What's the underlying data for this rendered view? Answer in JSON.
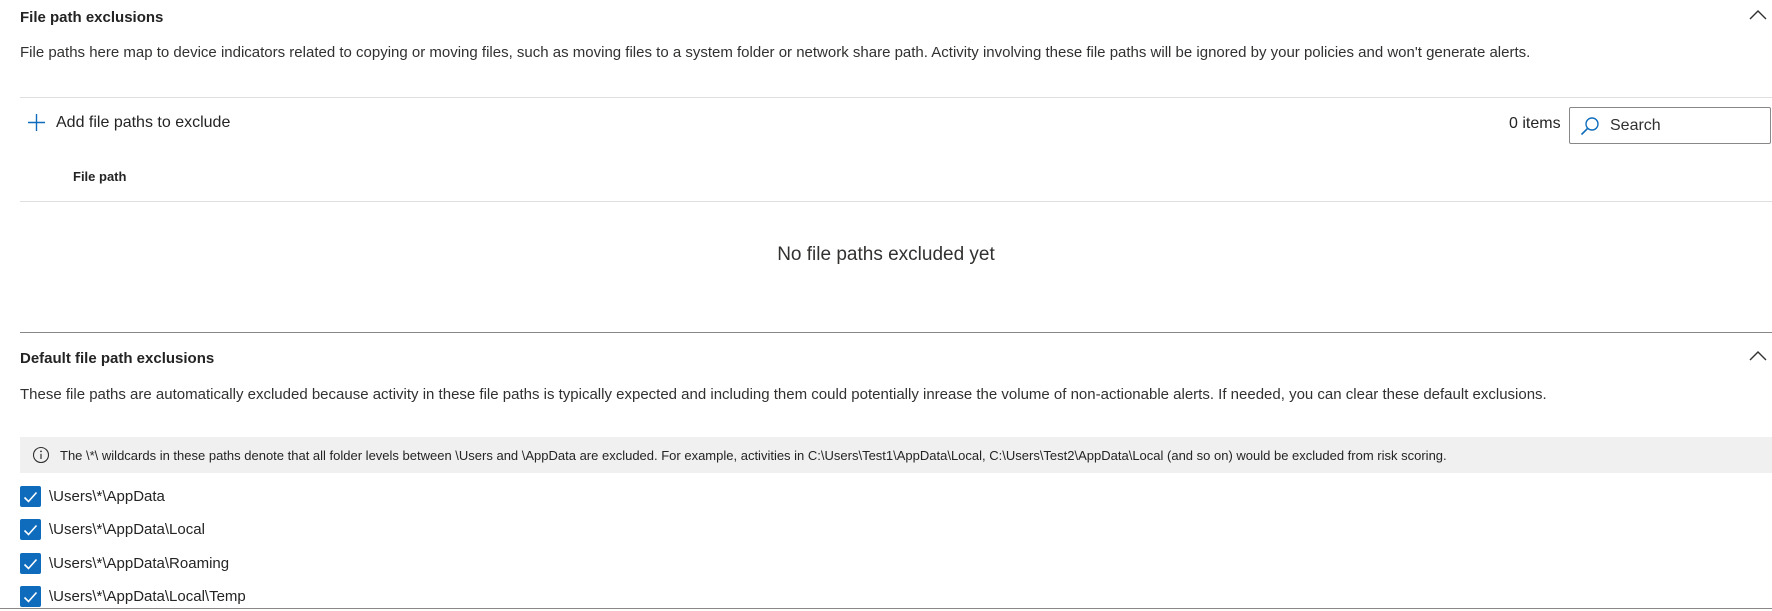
{
  "file_path_exclusions": {
    "title": "File path exclusions",
    "description": "File paths here map to device indicators related to copying or moving files, such as moving files to a system folder or network share path. Activity involving these file paths will be ignored by your policies and won't generate alerts.",
    "add_button_label": "Add file paths to exclude",
    "items_count": "0 items",
    "search_placeholder": "Search",
    "column_header": "File path",
    "empty_message": "No file paths excluded yet"
  },
  "default_exclusions": {
    "title": "Default file path exclusions",
    "description": "These file paths are automatically excluded because activity in these file paths is typically expected and including them could potentially inrease the volume of non-actionable alerts. If needed, you can clear these default exclusions.",
    "info_text": "The \\*\\ wildcards in these paths denote that all folder levels between \\Users and \\AppData are excluded. For example, activities in C:\\Users\\Test1\\AppData\\Local, C:\\Users\\Test2\\AppData\\Local (and so on) would be excluded from risk scoring.",
    "paths": [
      {
        "label": "\\Users\\*\\AppData",
        "checked": true
      },
      {
        "label": "\\Users\\*\\AppData\\Local",
        "checked": true
      },
      {
        "label": "\\Users\\*\\AppData\\Roaming",
        "checked": true
      },
      {
        "label": "\\Users\\*\\AppData\\Local\\Temp",
        "checked": true
      }
    ]
  },
  "colors": {
    "accent": "#0f6cbd",
    "info_bar_bg": "#f0f0f0",
    "divider": "#e1dfdd"
  },
  "icons": {
    "collapse": "chevron-up-icon",
    "add": "plus-icon",
    "search": "search-icon",
    "info": "info-icon",
    "check": "checkmark-icon"
  }
}
